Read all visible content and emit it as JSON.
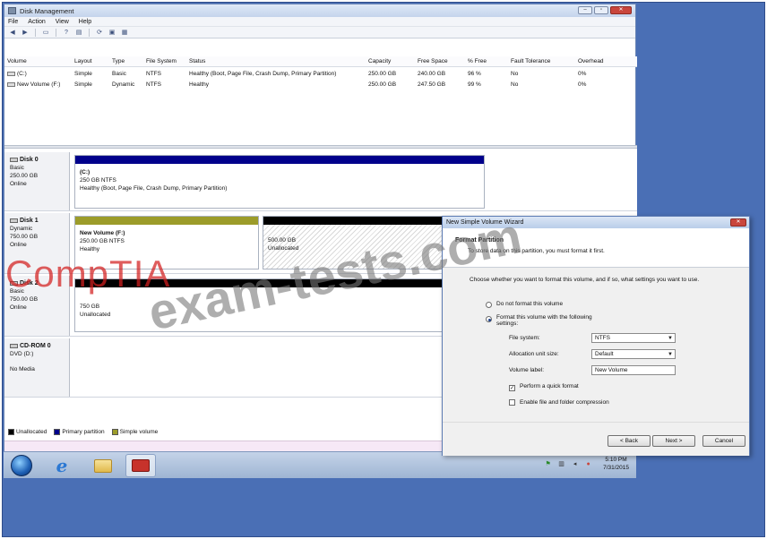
{
  "window": {
    "title": "Disk Management"
  },
  "menu": [
    "File",
    "Action",
    "View",
    "Help"
  ],
  "volume_list": {
    "columns": [
      "Volume",
      "Layout",
      "Type",
      "File System",
      "Status",
      "Capacity",
      "Free Space",
      "% Free",
      "Fault Tolerance",
      "Overhead"
    ],
    "rows": [
      {
        "volume": "(C:)",
        "layout": "Simple",
        "type": "Basic",
        "fs": "NTFS",
        "status": "Healthy (Boot, Page File, Crash Dump, Primary Partition)",
        "capacity": "250.00 GB",
        "free": "240.00 GB",
        "pct": "96 %",
        "ft": "No",
        "overhead": "0%"
      },
      {
        "volume": "New Volume (F:)",
        "layout": "Simple",
        "type": "Dynamic",
        "fs": "NTFS",
        "status": "Healthy",
        "capacity": "250.00 GB",
        "free": "247.50 GB",
        "pct": "99 %",
        "ft": "No",
        "overhead": "0%"
      }
    ]
  },
  "disks": [
    {
      "name": "Disk 0",
      "type": "Basic",
      "size": "250.00 GB",
      "state": "Online",
      "partitions": [
        {
          "name": "(C:)",
          "line1": "250 GB NTFS",
          "line2": "Healthy (Boot, Page File, Crash Dump, Primary Partition)"
        }
      ]
    },
    {
      "name": "Disk 1",
      "type": "Dynamic",
      "size": "750.00 GB",
      "state": "Online",
      "partitions": [
        {
          "name": "New Volume (F:)",
          "line1": "250.00 GB NTFS",
          "line2": "Healthy"
        },
        {
          "name": "",
          "line1": "500.00 GB",
          "line2": "Unallocated"
        }
      ]
    },
    {
      "name": "Disk 2",
      "type": "Basic",
      "size": "750.00 GB",
      "state": "Online",
      "partitions": [
        {
          "name": "",
          "line1": "750 GB",
          "line2": "Unallocated"
        }
      ]
    },
    {
      "name": "CD-ROM 0",
      "type": "DVD (D:)",
      "size": "",
      "state": "No Media",
      "partitions": []
    }
  ],
  "legend": [
    "Unallocated",
    "Primary partition",
    "Simple volume"
  ],
  "colors": {
    "unallocated": "#000000",
    "primary": "#00008b",
    "simple": "#9c9c2a"
  },
  "wizard": {
    "title": "New Simple Volume Wizard",
    "heading": "Format Partition",
    "subheading": "To store data on this partition, you must format it first.",
    "prompt": "Choose whether you want to format this volume, and if so, what settings you want to use.",
    "opt_noformat": "Do not format this volume",
    "opt_format": "Format this volume with the following settings:",
    "fs_label": "File system:",
    "fs_value": "NTFS",
    "alloc_label": "Allocation unit size:",
    "alloc_value": "Default",
    "vol_label": "Volume label:",
    "vol_value": "New Volume",
    "quick": "Perform a quick format",
    "compress": "Enable file and folder compression",
    "back": "< Back",
    "next": "Next >",
    "cancel": "Cancel"
  },
  "taskbar": {
    "time": "5:10 PM",
    "date": "7/31/2015"
  },
  "watermark": {
    "brand": "CompTIA",
    "site": "exam-tests.com"
  },
  "icons": [
    "back-arrow-icon",
    "forward-arrow-icon",
    "help-icon",
    "refresh-icon",
    "windows-start-icon",
    "internet-explorer-icon",
    "folder-icon",
    "toolbox-icon"
  ]
}
